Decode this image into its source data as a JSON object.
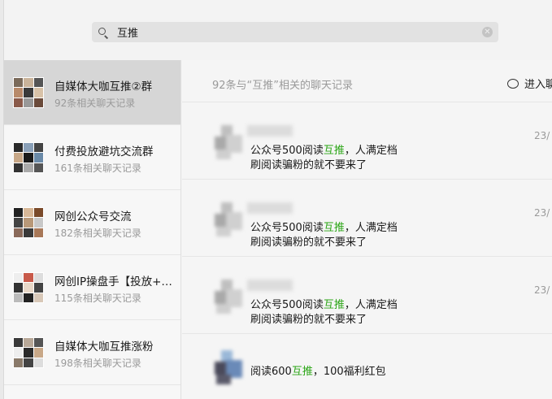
{
  "search": {
    "query": "互推"
  },
  "sidebar": {
    "groups": [
      {
        "name": "自媒体大咖互推②群",
        "sub": "92条相关聊天记录"
      },
      {
        "name": "付费投放避坑交流群",
        "sub": "161条相关聊天记录"
      },
      {
        "name": "网创公众号交流",
        "sub": "182条相关聊天记录"
      },
      {
        "name": "网创IP操盘手【投放+…",
        "sub": "115条相关聊天记录"
      },
      {
        "name": "自媒体大咖互推涨粉",
        "sub": "198条相关聊天记录"
      }
    ]
  },
  "main": {
    "result_count": "92条与“互推”相关的聊天记录",
    "enter_chat": "进入聊",
    "messages": [
      {
        "line1_pre": "公众号500阅读",
        "hl": "互推",
        "line1_post": "，人满定档",
        "line2": "刷阅读骗粉的就不要来了",
        "date": "23/"
      },
      {
        "line1_pre": "公众号500阅读",
        "hl": "互推",
        "line1_post": "，人满定档",
        "line2": "刷阅读骗粉的就不要来了",
        "date": "23/"
      },
      {
        "line1_pre": "公众号500阅读",
        "hl": "互推",
        "line1_post": "，人满定档",
        "line2": "刷阅读骗粉的就不要来了",
        "date": "23/"
      },
      {
        "line1_pre": "阅读600",
        "hl": "互推",
        "line1_post": "，100福利红包",
        "line2": "",
        "date": ""
      }
    ]
  },
  "colors": {
    "highlight": "#2aa515",
    "selected_bg": "#d6d6d6"
  },
  "icons": [
    "search-icon",
    "clear-icon",
    "chat-bubble-icon"
  ]
}
